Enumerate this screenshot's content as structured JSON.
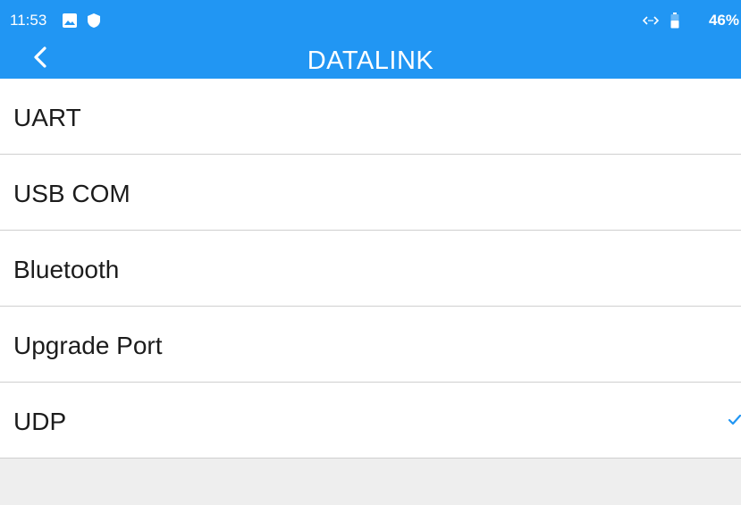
{
  "status_bar": {
    "time": "11:53",
    "battery_percent": "46%",
    "icons": [
      "image-icon",
      "shield-icon",
      "data-transfer-icon",
      "battery-icon"
    ]
  },
  "app_bar": {
    "title": "DATALINK",
    "back_icon": "chevron-left-icon"
  },
  "colors": {
    "header": "#2196f3",
    "check": "#2196f3",
    "background": "#eeeeee"
  },
  "list": {
    "items": [
      {
        "label": "UART",
        "selected": false
      },
      {
        "label": "USB COM",
        "selected": false
      },
      {
        "label": "Bluetooth",
        "selected": false
      },
      {
        "label": "Upgrade Port",
        "selected": false
      },
      {
        "label": "UDP",
        "selected": true
      }
    ]
  }
}
